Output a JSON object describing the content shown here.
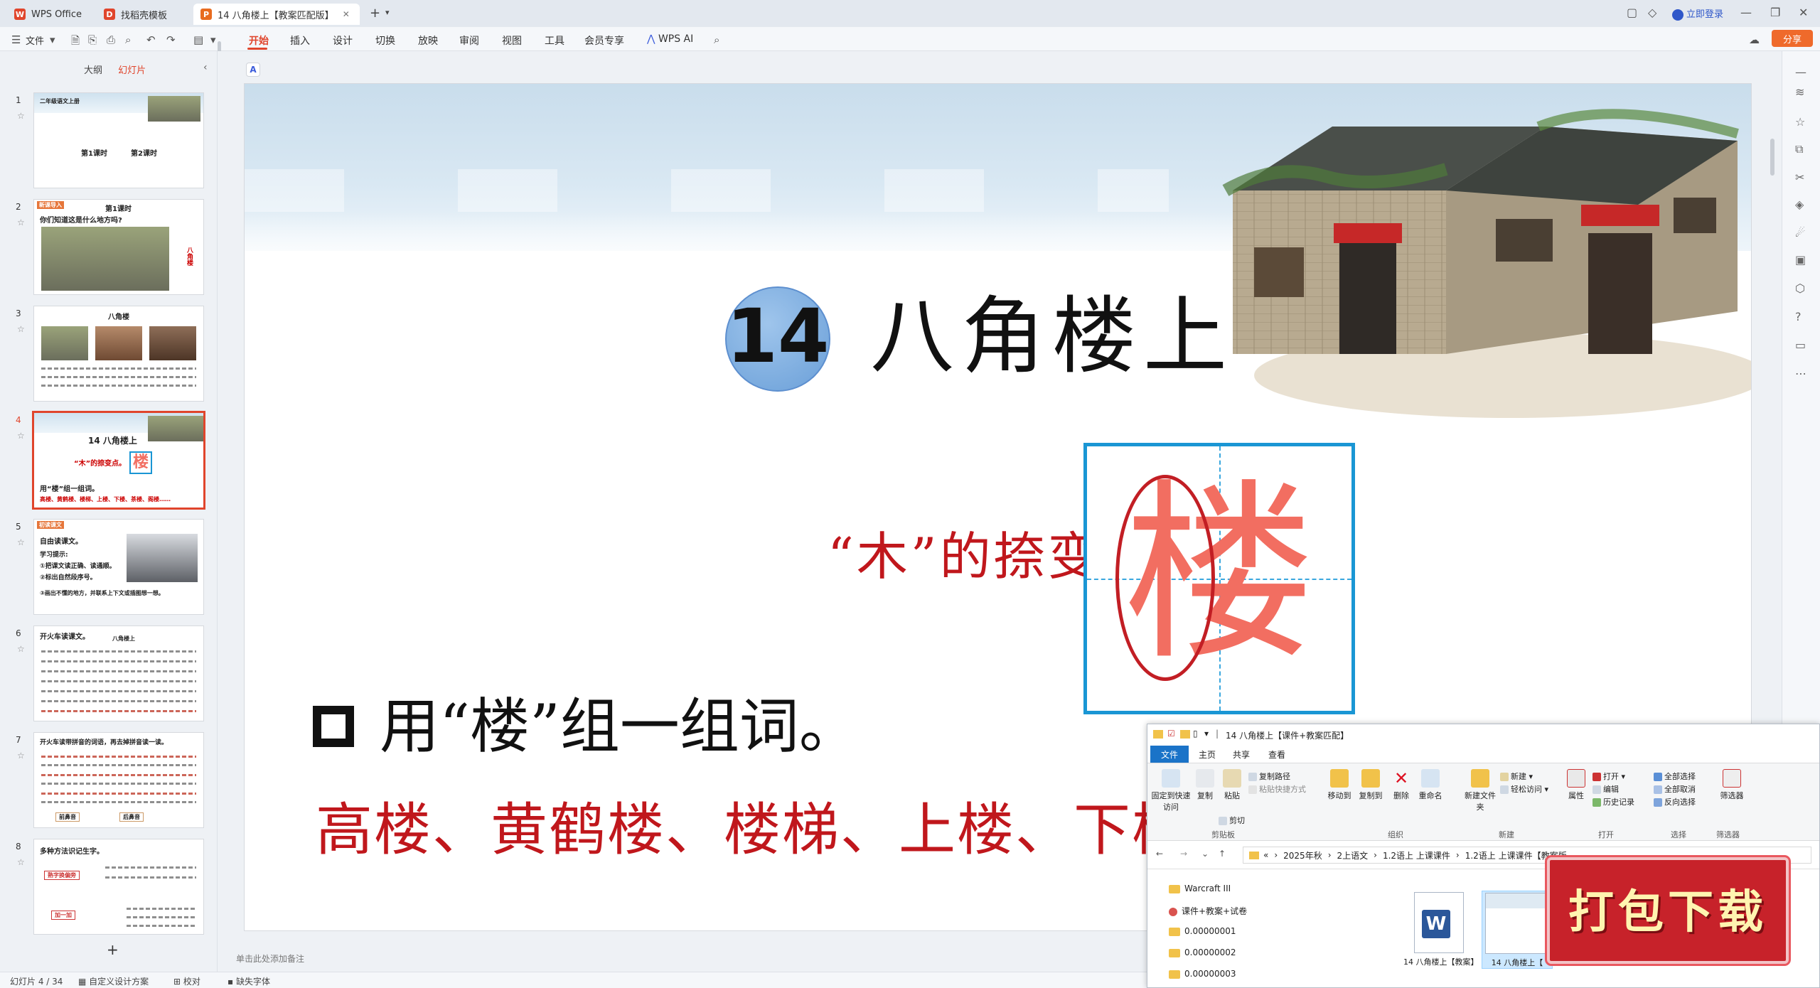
{
  "titlebar": {
    "tabs": [
      {
        "label": "WPS Office",
        "logo": "W",
        "color": "#e0452c"
      },
      {
        "label": "找稻壳模板",
        "logo": "D",
        "color": "#e0452c"
      },
      {
        "label": "14 八角楼上【教案匹配版】",
        "logo": "P",
        "color": "#e86b1f"
      }
    ],
    "login_label": "立即登录"
  },
  "menubar": {
    "file_label": "文件",
    "items": [
      "开始",
      "插入",
      "设计",
      "切换",
      "放映",
      "审阅",
      "视图",
      "工具",
      "会员专享",
      "WPS AI"
    ],
    "active": "开始",
    "share_label": "分享"
  },
  "leftpanel": {
    "tabs": [
      "大纲",
      "幻灯片"
    ],
    "active_tab": "幻灯片",
    "slides": [
      {
        "num": "1",
        "title": "二年级语文上册",
        "line1": "第1课时",
        "line2": "第2课时"
      },
      {
        "num": "2",
        "tag": "新课导入",
        "title": "第1课时",
        "q": "你们知道这是什么地方吗?",
        "side": "八角楼"
      },
      {
        "num": "3",
        "title": "八角楼"
      },
      {
        "num": "4",
        "title": "14 八角楼上",
        "red": "“木”的捺变点。",
        "task": "用“楼”组一组词。",
        "words": "高楼、黄鹤楼、楼梯、上楼、下楼、茶楼、阁楼……"
      },
      {
        "num": "5",
        "tag": "初读课文",
        "title": "自由读课文。",
        "l1": "学习提示:",
        "l2": "①把课文读正确、读通顺。",
        "l3": "②标出自然段序号。",
        "l4": "③画出不懂的地方，并联系上下文或插图想一想。"
      },
      {
        "num": "6",
        "title": "开火车读课文。",
        "sub": "八角楼上"
      },
      {
        "num": "7",
        "title": "开火车读带拼音的词语，再去掉拼音读一读。",
        "b1": "前鼻音",
        "b2": "后鼻音"
      },
      {
        "num": "8",
        "title": "多种方法识记生字。",
        "tag1": "熟字换偏旁",
        "tag2": "加一加"
      }
    ],
    "selected": 3
  },
  "slide": {
    "number": "14",
    "title": "八角楼上",
    "red_line": "“木”的捺变点。",
    "char": "楼",
    "task": "用“楼”组一组词。",
    "words": "高楼、黄鹤楼、楼梯、上楼、下楼"
  },
  "notes_placeholder": "单击此处添加备注",
  "statusbar": {
    "slide_index": "幻灯片 4 / 34",
    "design": "自定义设计方案",
    "proof": "校对",
    "font_missing": "缺失字体"
  },
  "explorer": {
    "title": "14 八角楼上【课件+教案匹配】",
    "tabs": [
      "文件",
      "主页",
      "共享",
      "查看"
    ],
    "ribbon": {
      "pin": "固定到快速访问",
      "copy": "复制",
      "paste": "粘贴",
      "copy_path": "复制路径",
      "paste_shortcut": "粘贴快捷方式",
      "cut": "剪切",
      "move_to": "移动到",
      "copy_to": "复制到",
      "delete": "删除",
      "rename": "重命名",
      "new_folder": "新建文件夹",
      "new_item": "新建",
      "easy_access": "轻松访问",
      "properties": "属性",
      "open": "打开",
      "edit": "编辑",
      "history": "历史记录",
      "select_all": "全部选择",
      "select_none": "全部取消",
      "invert": "反向选择",
      "filter": "筛选器",
      "groups": [
        "剪贴板",
        "组织",
        "新建",
        "打开",
        "选择",
        "筛选器"
      ]
    },
    "path": [
      "«",
      "2025年秋",
      "2上语文",
      "1.2语上 上课课件",
      "1.2语上 上课课件【教案版"
    ],
    "nav": [
      "Warcraft III",
      "课件+教案+试卷",
      "0.00000001",
      "0.00000002",
      "0.00000003"
    ],
    "files": [
      {
        "name": "14 八角楼上【教案】",
        "type": "word"
      },
      {
        "name": "14 八角楼上【",
        "type": "ppt"
      }
    ]
  },
  "download_banner": "打包下载"
}
